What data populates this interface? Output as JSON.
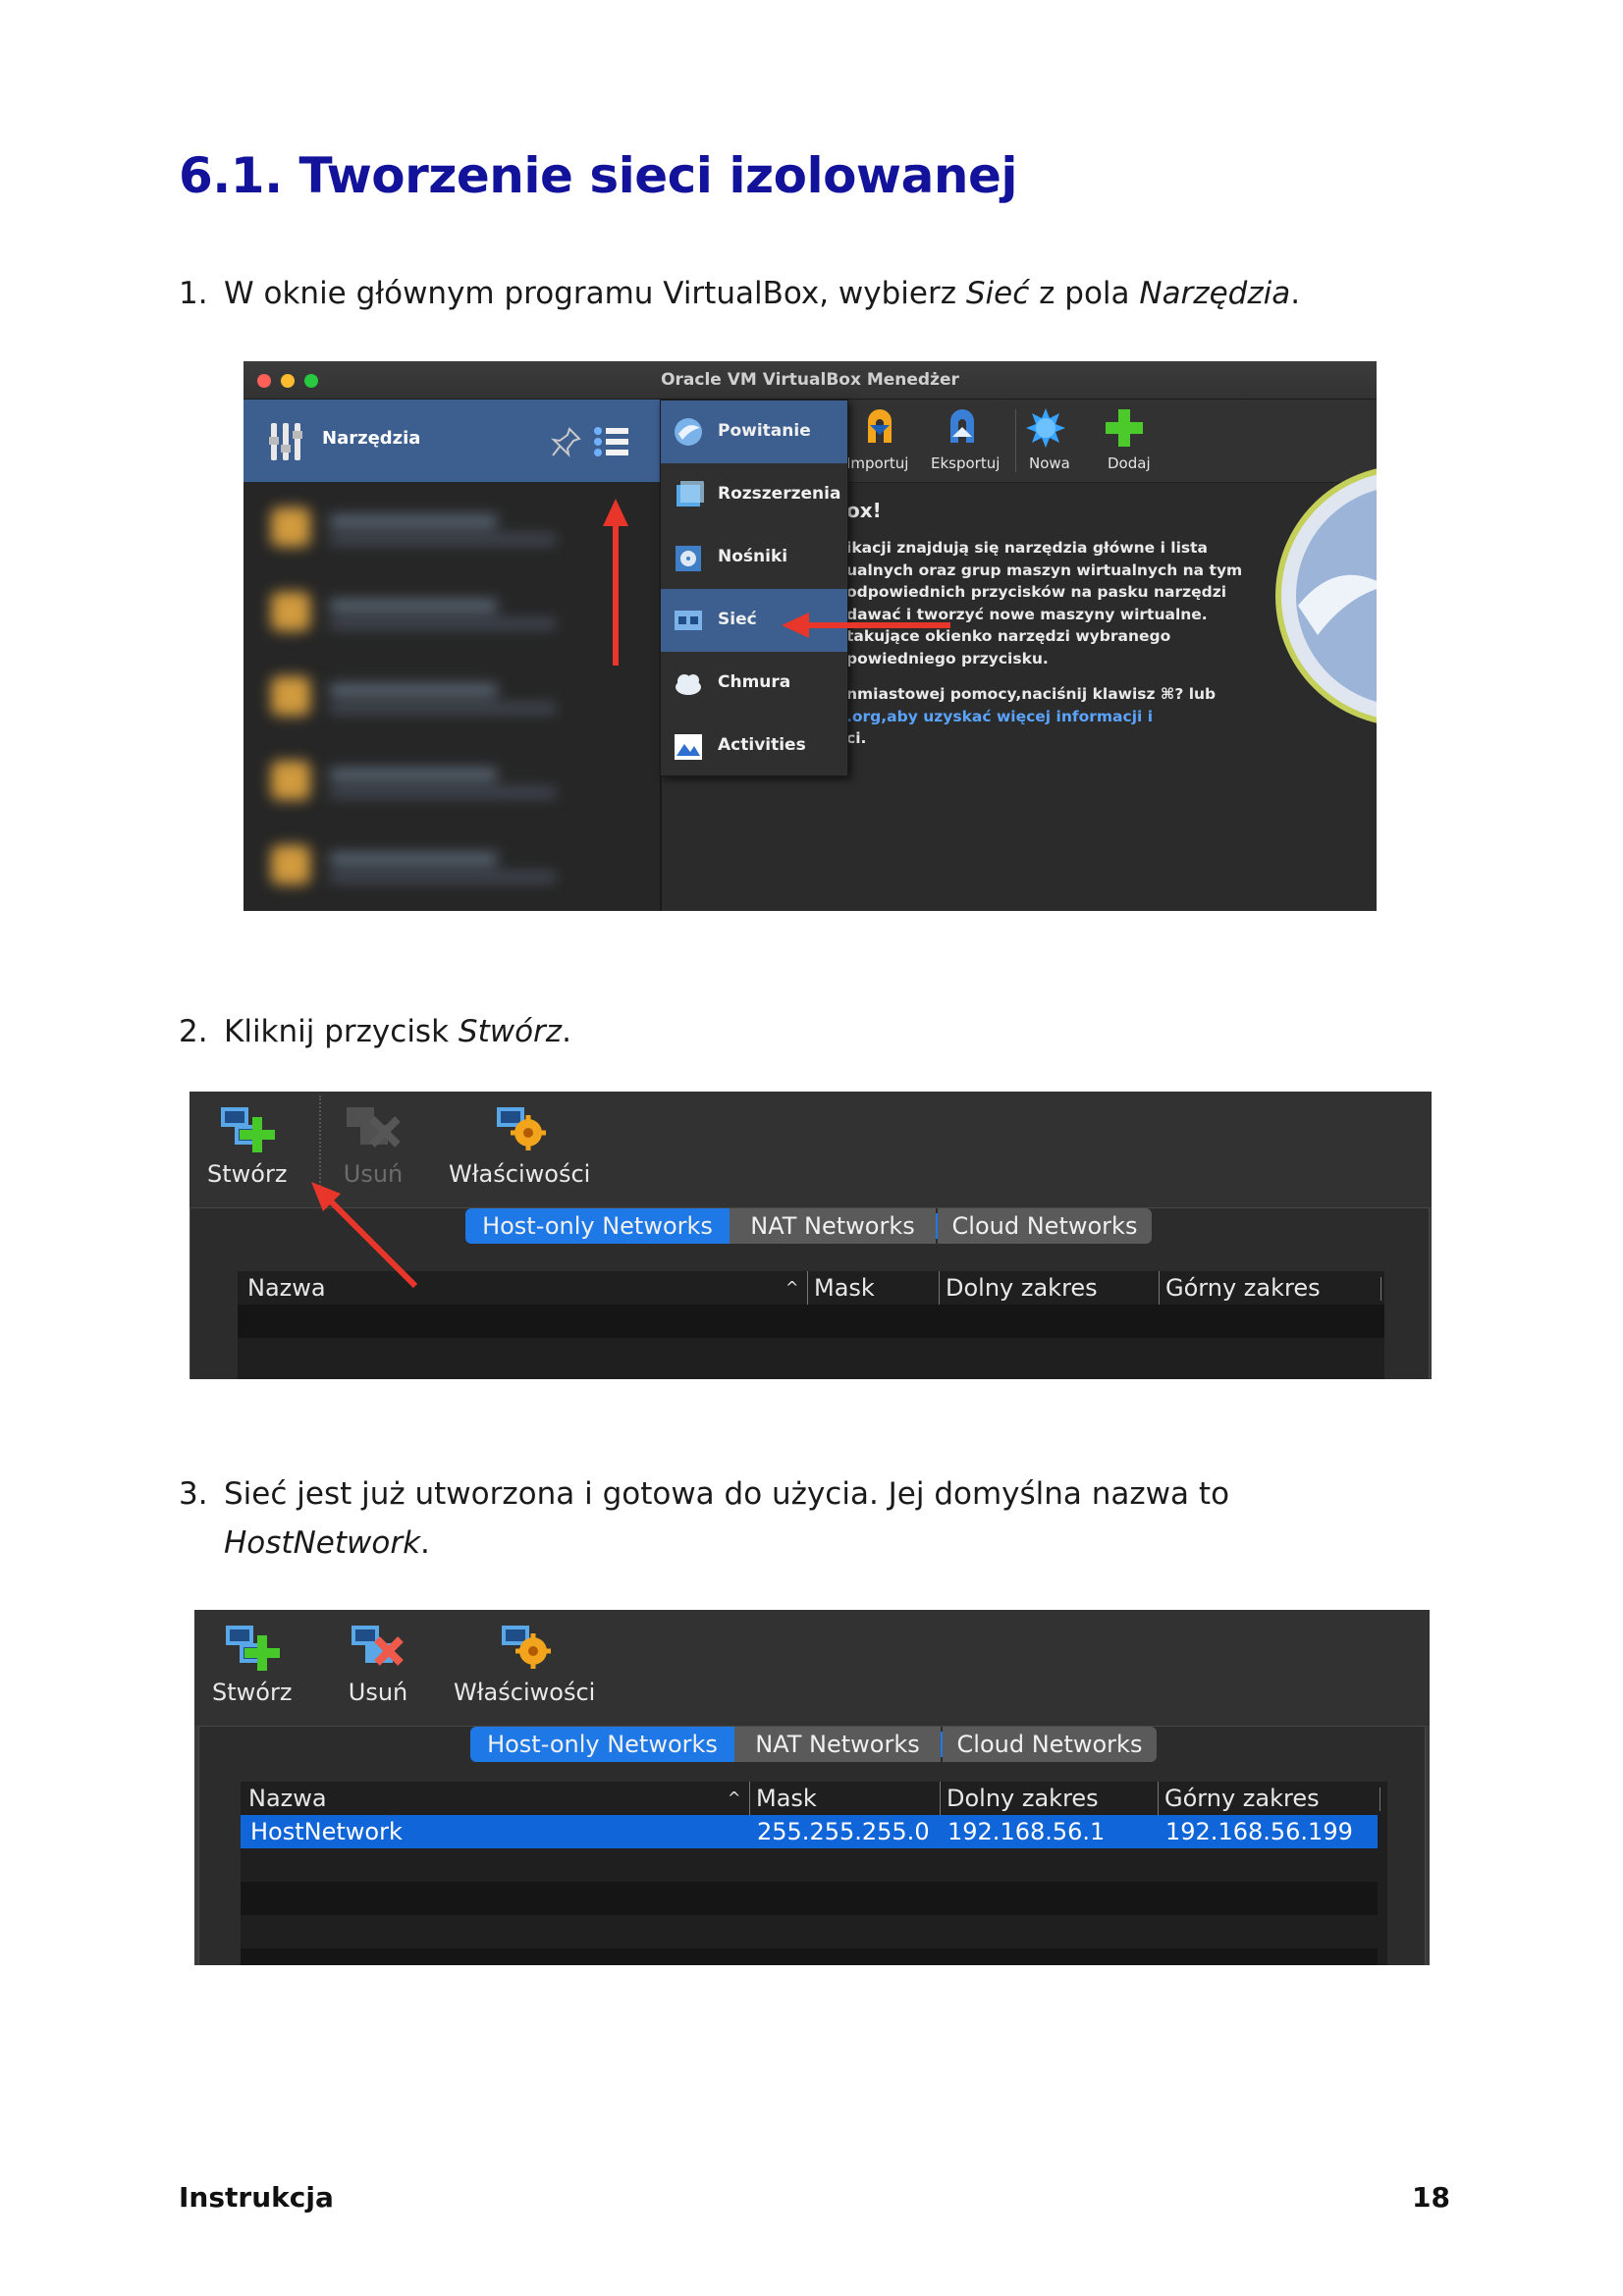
{
  "heading": "6.1.  Tworzenie sieci izolowanej",
  "steps": [
    {
      "num": "1.",
      "pre": "W oknie głównym programu VirtualBox, wybierz ",
      "em1": "Sieć",
      "mid": " z pola ",
      "em2": "Narzędzia",
      "post": "."
    },
    {
      "num": "2.",
      "pre": "Kliknij przycisk ",
      "em1": "Stwórz",
      "post": "."
    },
    {
      "num": "3.",
      "pre": "Sieć jest już utworzona i gotowa do użycia. Jej domyślna nazwa to",
      "em1": "HostNetwork",
      "post": "."
    }
  ],
  "shot1": {
    "window_title": "Oracle VM VirtualBox Menedżer",
    "tools_label": "Narzędzia",
    "menu": [
      {
        "label": "Powitanie",
        "icon": "welcome-icon",
        "color": "#4a90d9",
        "active": true
      },
      {
        "label": "Rozszerzenia",
        "icon": "extensions-icon",
        "color": "#5aa9e6",
        "active": false
      },
      {
        "label": "Nośniki",
        "icon": "media-icon",
        "color": "#3f7fc7",
        "active": false
      },
      {
        "label": "Sieć",
        "icon": "network-icon",
        "color": "#4a8ccf",
        "active": true
      },
      {
        "label": "Chmura",
        "icon": "cloud-icon",
        "color": "#cfd8e4",
        "active": false
      },
      {
        "label": "Activities",
        "icon": "activities-icon",
        "color": "#3d7fd0",
        "active": false
      }
    ],
    "toolbar": [
      {
        "label": "Importuj",
        "icon": "import-icon"
      },
      {
        "label": "Eksportuj",
        "icon": "export-icon"
      },
      {
        "label": "Nowa",
        "icon": "new-icon"
      },
      {
        "label": "Dodaj",
        "icon": "add-icon"
      }
    ],
    "welcome_heading": "ox!",
    "welcome_lines": [
      "ikacji znajdują się narzędzia główne i lista",
      "ualnych oraz grup maszyn wirtualnych na tym",
      "odpowiednich przycisków na pasku narzędzi",
      "dawać i tworzyć nowe maszyny wirtualne.",
      "takujące okienko narzędzi wybranego",
      "powiedniego przycisku."
    ],
    "welcome_lines2": [
      "nmiastowej pomocy,naciśnij klawisz ⌘? lub",
      ".org,aby uzyskać więcej informacji i",
      "ci."
    ],
    "arrow_color": "#e8362a"
  },
  "shot2": {
    "tools": [
      {
        "label": "Stwórz",
        "icon": "create-network-icon",
        "enabled": true
      },
      {
        "label": "Usuń",
        "icon": "remove-network-icon",
        "enabled": false
      },
      {
        "label": "Właściwości",
        "icon": "properties-icon",
        "enabled": true
      }
    ],
    "tabs": [
      "Host-only Networks",
      "NAT Networks",
      "Cloud Networks"
    ],
    "columns": [
      "Nazwa",
      "Mask",
      "Dolny zakres",
      "Górny zakres"
    ],
    "sort_indicator": "^"
  },
  "shot3": {
    "tools": [
      {
        "label": "Stwórz",
        "icon": "create-network-icon",
        "enabled": true
      },
      {
        "label": "Usuń",
        "icon": "remove-network-icon",
        "enabled": true
      },
      {
        "label": "Właściwości",
        "icon": "properties-icon",
        "enabled": true
      }
    ],
    "tabs": [
      "Host-only Networks",
      "NAT Networks",
      "Cloud Networks"
    ],
    "columns": [
      "Nazwa",
      "Mask",
      "Dolny zakres",
      "Górny zakres"
    ],
    "sort_indicator": "^",
    "rows": [
      {
        "name": "HostNetwork",
        "mask": "255.255.255.0",
        "lower": "192.168.56.1",
        "upper": "192.168.56.199"
      }
    ]
  },
  "footer": {
    "left": "Instrukcja",
    "right": "18"
  }
}
